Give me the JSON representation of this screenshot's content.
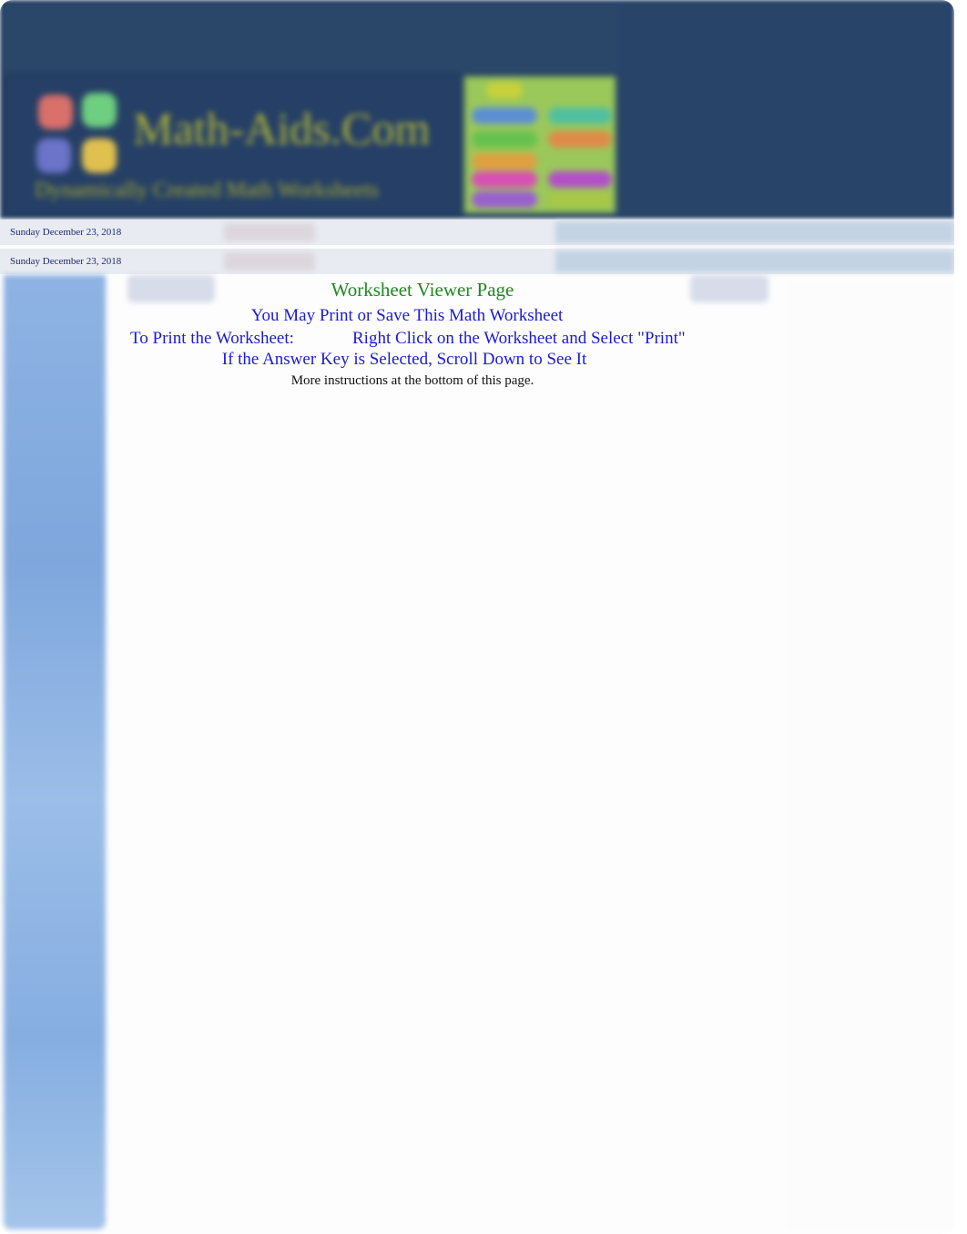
{
  "header": {
    "brand_title": "Math-Aids.Com",
    "brand_tagline": "Dynamically Created Math Worksheets",
    "menu_colors": [
      "#c9d13a",
      "#5b8ed6",
      "#4fc0a0",
      "#66c24e",
      "#e08a48",
      "#e0a040",
      "#d84fb4",
      "#b24fc8",
      "#9a5fd0",
      "#a6c846"
    ]
  },
  "date_bars": [
    {
      "date": "Sunday December 23, 2018"
    },
    {
      "date": "Sunday December 23, 2018"
    }
  ],
  "main": {
    "title": "Worksheet Viewer Page",
    "print_save": "You May Print or Save This Math Worksheet",
    "print_label": "To Print the Worksheet:",
    "print_action": "Right Click on the Worksheet and Select \"Print\"",
    "answer_key_note": "If the Answer Key is Selected, Scroll Down to See It",
    "more_instructions": "More instructions at the bottom of this page."
  },
  "colors": {
    "header_bg": "#284468",
    "title_green": "#1e8a1e",
    "instruction_blue": "#1b1bd6",
    "date_text": "#1e2a6e",
    "sidebar_blue": "#8eb3e3"
  }
}
